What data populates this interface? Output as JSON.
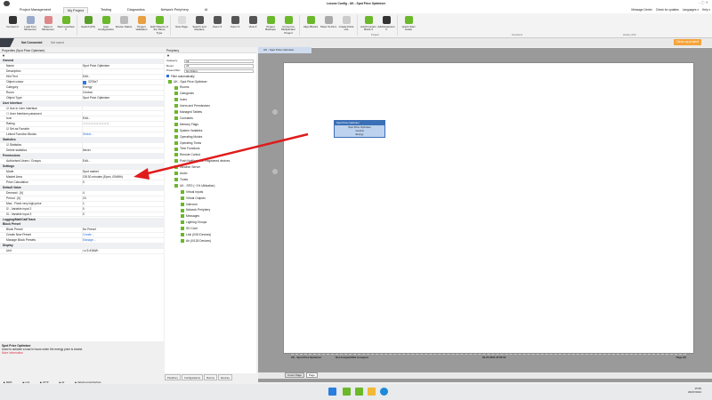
{
  "window": {
    "title": "Loxone Config - UK - Spot Price Optimiser",
    "quick_access": "▾"
  },
  "menu_tabs": [
    "Project Management",
    "My Project",
    "Testing",
    "Diagnostics",
    "Network Periphery",
    "AI"
  ],
  "top_links": [
    "Message Center",
    "Check for updates",
    "Languages ▾",
    "Help ▾"
  ],
  "ribbon": [
    {
      "label": "Connect ▾",
      "color": "#333"
    },
    {
      "label": "Load from Miniserver",
      "color": "#9ac"
    },
    {
      "label": "Save in Miniserver",
      "color": "#d88"
    },
    {
      "label": "Start LiveView ▾",
      "color": "#6bb82a"
    },
    {
      "sep": true
    },
    {
      "label": "Search (F5)",
      "color": "#5a9e2a"
    },
    {
      "label": "Auto Configuration",
      "color": "#6bb82a"
    },
    {
      "label": "Device Status",
      "color": "#bbb"
    },
    {
      "label": "Project Validation",
      "color": "#e8a040"
    },
    {
      "label": "Edit Objects of the Same Type",
      "color": "#6bb82a"
    },
    {
      "sep": true
    },
    {
      "label": "New Page",
      "color": "#ddd"
    },
    {
      "label": "Search and Replace",
      "color": "#555"
    },
    {
      "label": "Zoom ▾",
      "color": "#555"
    },
    {
      "label": "Zoom ▾",
      "color": "#555"
    },
    {
      "label": "View ▾",
      "color": "#555"
    },
    {
      "label": "Project Backups",
      "color": "#6bb82a"
    },
    {
      "label": "Convert to Multiplicator Project",
      "color": "#6bb82a"
    },
    {
      "sep": true
    },
    {
      "label": "Align Blocks",
      "color": "#6bb82a"
    },
    {
      "label": "Show To-Do's",
      "color": "#aaa"
    },
    {
      "label": "Create Parts List",
      "color": "#ccc"
    },
    {
      "sep": true
    },
    {
      "label": "Add Function Block ▾",
      "color": "#6bb82a"
    },
    {
      "label": "Add Extension ▾",
      "color": "#333"
    },
    {
      "sep": true
    },
    {
      "label": "Quick Start Guide",
      "color": "#6bb82a"
    }
  ],
  "ribbon_groups": [
    "Project",
    "Functions",
    "Library (F5)"
  ],
  "status": {
    "connection": "Not Connected",
    "saved": "Not saved",
    "cleanup": "Clean up project"
  },
  "properties": {
    "header": "Properties (Spot Price Optimiser)",
    "rows": [
      {
        "h": "General"
      },
      {
        "k": "Name",
        "v": "Spot Price Optimiser"
      },
      {
        "k": "Description",
        "v": ""
      },
      {
        "k": "Hint Text",
        "v": "Edit..."
      },
      {
        "k": "Object colour",
        "v": "3276e7"
      },
      {
        "k": "Category",
        "v": "Energy"
      },
      {
        "k": "Room",
        "v": "Central"
      },
      {
        "k": "Object Type",
        "v": "Spot Price Optimiser"
      },
      {
        "h": "User Interface"
      },
      {
        "k": "☑ Use in User Interface",
        "v": ""
      },
      {
        "k": "☐ User Interface password",
        "v": ""
      },
      {
        "k": "Icon",
        "v": "Edit..."
      },
      {
        "k": "Rating",
        "v": "☆☆☆☆☆☆☆☆☆☆"
      },
      {
        "k": "☑ Set as Favorite",
        "v": ""
      },
      {
        "k": "Linked Function Blocks",
        "v": "Select...",
        "link": true
      },
      {
        "h": "Statistics"
      },
      {
        "k": "☑ Statistics",
        "v": ""
      },
      {
        "k": "Delete statistics",
        "v": "Never"
      },
      {
        "h": "Permissions"
      },
      {
        "k": "Authorised Users / Groups",
        "v": "Edit..."
      },
      {
        "h": "Settings"
      },
      {
        "k": "Mode",
        "v": "Spot market"
      },
      {
        "k": "Market Area",
        "v": "GB 30-minutes (Epex, £/MWh)"
      },
      {
        "k": "Price Calculation",
        "v": "0"
      },
      {
        "h": "Default Value"
      },
      {
        "k": "Demand - [h]",
        "v": "4"
      },
      {
        "k": "Period - [h]",
        "v": "24"
      },
      {
        "k": "Max - Fixed very high price",
        "v": "1"
      },
      {
        "k": "I2 - Variable input 2",
        "v": "0"
      },
      {
        "k": "I3 - Variable input 3",
        "v": "0"
      },
      {
        "h": "Logging/Mail/Call/Track"
      },
      {
        "h": "Block Preset"
      },
      {
        "k": "Block Preset",
        "v": "No Preset"
      },
      {
        "k": "Create New Preset",
        "v": "Create...",
        "link": true
      },
      {
        "k": "Manage Block Presets",
        "v": "Manage...",
        "link": true
      },
      {
        "h": "Display"
      },
      {
        "k": "Unit",
        "v": "<v.3>£/kWh"
      }
    ]
  },
  "description": {
    "title": "Spot Price Optimiser",
    "text": "Used to activate a load in hours when the energy price is lowest.",
    "more": "More information"
  },
  "play_row": [
    "SERF",
    "Link",
    "HTTP",
    "Air",
    "Valve/Loxone/Interface"
  ],
  "periphery": {
    "header": "Periphery",
    "filters": [
      {
        "label": "Category:",
        "value": "All"
      },
      {
        "label": "Room:",
        "value": "All"
      },
      {
        "label": "Preset filter:",
        "value": "No Filters"
      }
    ],
    "auto_filter": "Filter automatically",
    "tree": [
      [
        "UK - Spot Price Optimiser",
        0
      ],
      [
        "Rooms",
        1
      ],
      [
        "Categories",
        1
      ],
      [
        "Icons",
        1
      ],
      [
        "Users and Permissions",
        1
      ],
      [
        "Managed Tablets",
        1
      ],
      [
        "Constants",
        1
      ],
      [
        "Memory Flags",
        1
      ],
      [
        "System Variables",
        1
      ],
      [
        "Operating Modes",
        1
      ],
      [
        "Operating Times",
        1
      ],
      [
        "Time Functions",
        1
      ],
      [
        "Remote Control",
        1
      ],
      [
        "Push Notifications: Registered devices",
        1
      ],
      [
        "Weather Server",
        1
      ],
      [
        "Audio",
        1
      ],
      [
        "Trusts",
        1
      ],
      [
        "UK - SPO  (~1% Utilization)",
        1
      ],
      [
        "Virtual Inputs",
        2
      ],
      [
        "Virtual Outputs",
        2
      ],
      [
        "Intercom",
        2
      ],
      [
        "Network Periphery",
        2
      ],
      [
        "Messages",
        2
      ],
      [
        "Lighting Groups",
        2
      ],
      [
        "SD Card",
        2
      ],
      [
        "Link  (0/30 Devices)",
        2
      ],
      [
        "Air  (0/128 Devices)",
        2
      ]
    ],
    "tabs": [
      "Periphery",
      "Configurations",
      "Rooms",
      "Devices"
    ]
  },
  "document": {
    "tab": "UK - Spot Price Optimiser",
    "block_title": "Spot Price Optimiser",
    "block_sub": "Spot Price Optimiser",
    "block_room": "Central",
    "block_cat": "Energy",
    "footer": {
      "project": "UK - Spot Price Optimiser",
      "assigned": "Not Assigned/Not Assigned",
      "date": "29-07-2024 15:56:03",
      "page": "Page 2/2"
    },
    "sheets": [
      "Cover Page",
      "Page"
    ]
  },
  "taskbar": {
    "time": "15:56",
    "date": "29/07/2024"
  }
}
